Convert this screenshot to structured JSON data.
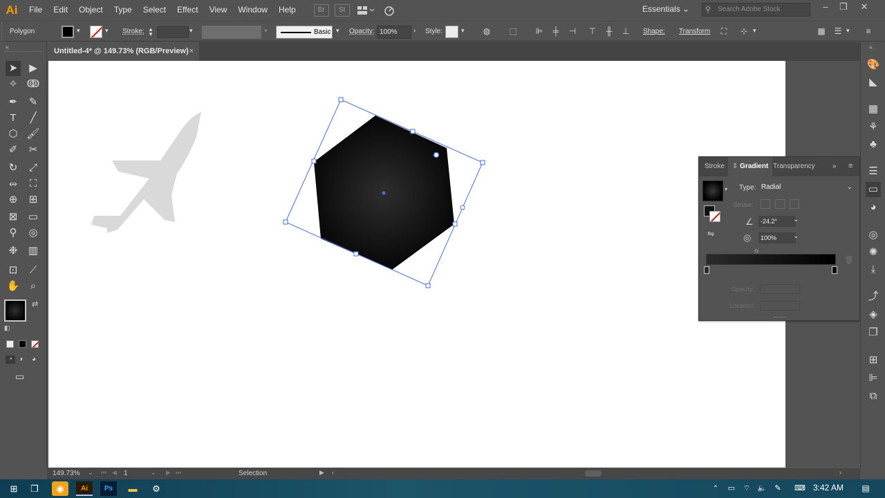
{
  "app": {
    "logo": "Ai"
  },
  "menu": [
    "File",
    "Edit",
    "Object",
    "Type",
    "Select",
    "Effect",
    "View",
    "Window",
    "Help"
  ],
  "menubar_icons": {
    "bridge": "Br",
    "stock": "St"
  },
  "workspace": "Essentials",
  "stock_search": {
    "placeholder": "Search Adobe Stock"
  },
  "control": {
    "selection_type": "Polygon",
    "stroke_label": "Stroke:",
    "brush_label": "Basic",
    "opacity_label": "Opacity:",
    "opacity_value": "100%",
    "style_label": "Style:",
    "shape_label": "Shape:",
    "transform_label": "Transform"
  },
  "document": {
    "tab_title": "Untitled-4* @ 149.73% (RGB/Preview)",
    "close": "×"
  },
  "gradient_panel": {
    "tabs": [
      "Stroke",
      "Gradient",
      "Transparency"
    ],
    "type_label": "Type:",
    "type_value": "Radial",
    "stroke_label": "Stroke:",
    "angle_value": "-24.2°",
    "aspect_value": "100%",
    "opacity_label": "Opacity:",
    "location_label": "Location:"
  },
  "status": {
    "zoom": "149.73%",
    "artboard": "1",
    "tool": "Selection"
  },
  "taskbar": {
    "time": "3:42 AM"
  },
  "colors": {
    "ui_bg": "#535353",
    "artboard": "#ffffff",
    "selection": "#4a6fd6",
    "airplane": "#d9d9d9",
    "logo": "#ff9a00"
  }
}
